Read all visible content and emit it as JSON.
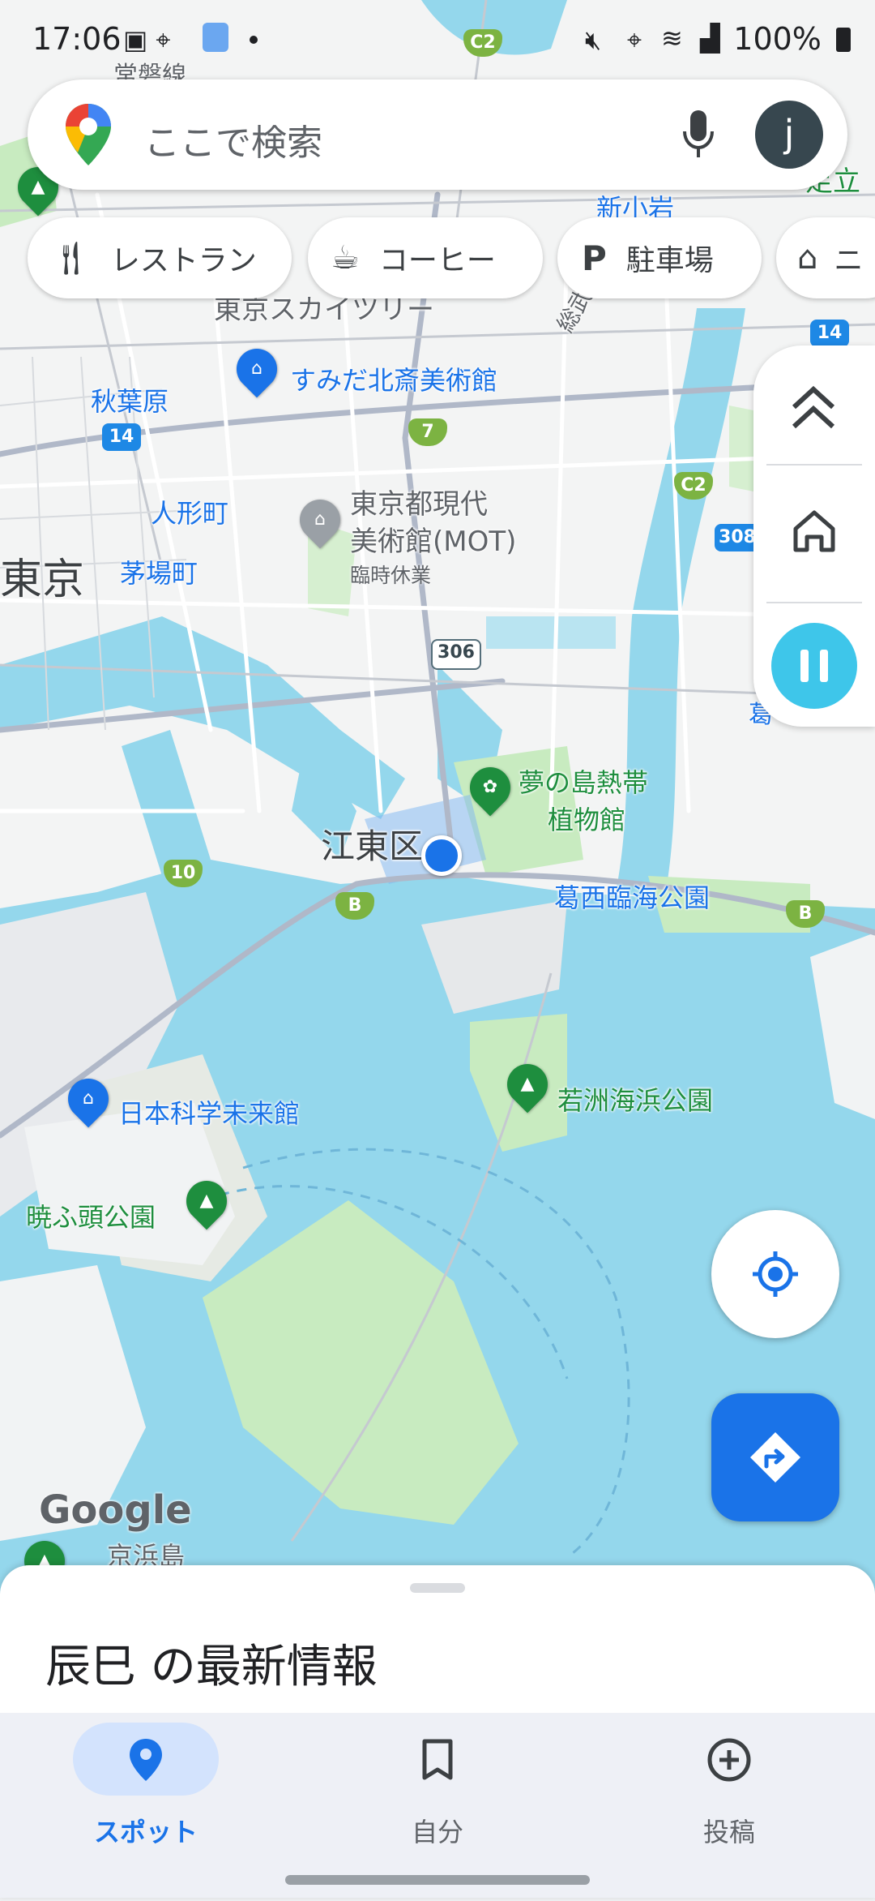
{
  "status_bar": {
    "time": "17:06",
    "battery": "100%"
  },
  "search": {
    "placeholder": "ここで検索",
    "avatar_letter": "j"
  },
  "chips": [
    {
      "label": "レストラン",
      "icon": "restaurant-icon"
    },
    {
      "label": "コーヒー",
      "icon": "coffee-icon"
    },
    {
      "label": "駐車場",
      "icon": "parking-icon"
    },
    {
      "label": "ニ",
      "icon": "hotel-icon"
    }
  ],
  "map": {
    "labels": {
      "joban": "常磐線",
      "skytree": "東京スカイツリー",
      "adachi": "足立",
      "shinkoiwa": "新小岩",
      "sokubu": "総武",
      "hokusai": "すみだ北斎美術館",
      "akihabara": "秋葉原",
      "ningyocho": "人形町",
      "tokyo": "東京",
      "kayabacho": "茅場町",
      "mot_line1": "東京都現代",
      "mot_line2": "美術館(MOT)",
      "mot_status": "臨時休業",
      "yumenoshima_line1": "夢の島熱帯",
      "yumenoshima_line2": "植物館",
      "koto": "江東区",
      "kasai": "葛西臨海公園",
      "wakasu": "若洲海浜公園",
      "miraikan": "日本科学未来館",
      "akatsuki": "暁ふ頭公園",
      "keihinjima": "京浜島",
      "kasai_edge": "葛",
      "google": "Google"
    },
    "shields": {
      "c2_top": "C2",
      "r14_right": "14",
      "r7": "7",
      "r14_left": "14",
      "c2_right": "C2",
      "r308": "308",
      "r306": "306",
      "r10": "10",
      "b_left": "B",
      "b_right": "B"
    }
  },
  "sheet": {
    "title": "辰巳 の最新情報"
  },
  "bottom_nav": [
    {
      "label": "スポット",
      "icon": "location-pin-icon",
      "active": true
    },
    {
      "label": "自分",
      "icon": "bookmark-icon",
      "active": false
    },
    {
      "label": "投稿",
      "icon": "add-circle-icon",
      "active": false
    }
  ],
  "colors": {
    "accent": "#1a73e8",
    "water": "#94d7ec",
    "park": "#c8ebc0",
    "land": "#f3f4f4",
    "fab_directions": "#1a73e8",
    "live_button": "#3ec6ea"
  }
}
